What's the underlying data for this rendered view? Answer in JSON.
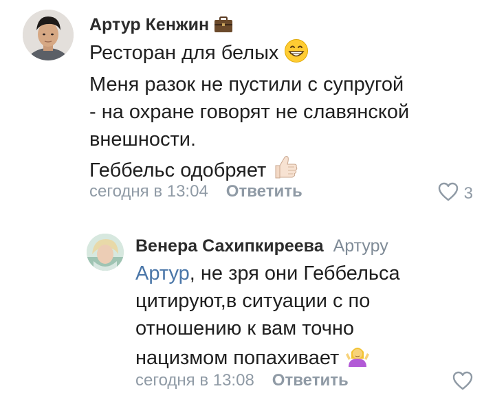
{
  "comments": [
    {
      "author": "Артур Кенжин",
      "lines": [
        "Ресторан для белых",
        "Меня разок не пустили с супругой",
        "- на охране говорят не славянской",
        "внешности.",
        "Геббельс одобряет"
      ],
      "emojis": [
        "grinning-face",
        "thumbs-up"
      ],
      "timestamp": "сегодня в 13:04",
      "reply_label": "Ответить",
      "like_count": "3"
    },
    {
      "author": "Венера Сахипкиреева",
      "reply_to": "Артуру",
      "mention": "Артур",
      "lines": [
        ", не зря они Геббельса",
        "цитируют,в ситуации с по",
        "отношению к  вам точно",
        "нацизмом попахивает"
      ],
      "emojis": [
        "person-shrugging"
      ],
      "timestamp": "сегодня в 13:08",
      "reply_label": "Ответить"
    }
  ],
  "colors": {
    "meta_gray": "#8f9aa5",
    "mention_blue": "#4a76a8",
    "reply_to_gray": "#7f8b97"
  }
}
